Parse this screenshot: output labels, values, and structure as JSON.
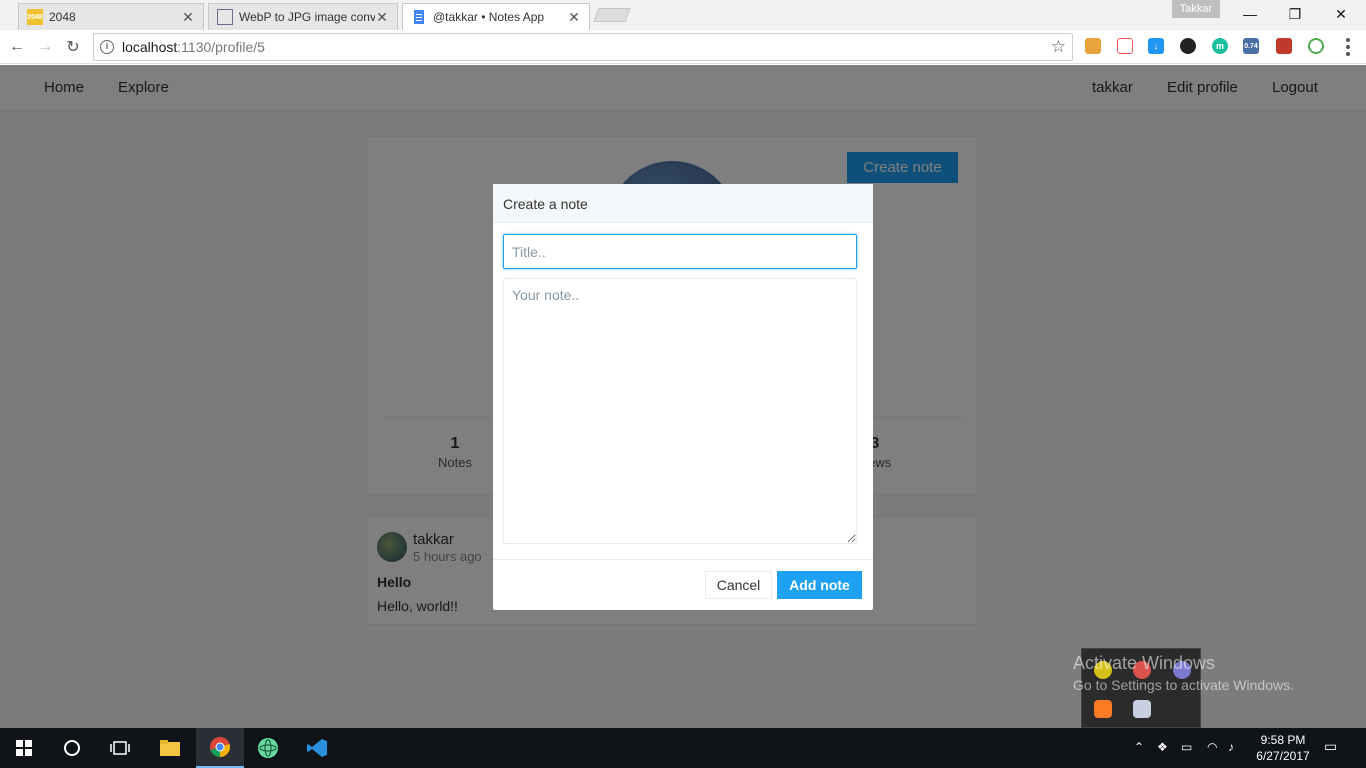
{
  "browser": {
    "tabs": [
      {
        "title": "2048",
        "favicon_text": "2048",
        "favicon_color": "#edc22e",
        "active": false
      },
      {
        "title": "WebP to JPG image conv",
        "favicon_text": "",
        "favicon_color": "#6b6b8f",
        "active": false
      },
      {
        "title": "@takkar • Notes App",
        "favicon_text": "",
        "favicon_color": "#4285f4",
        "active": true
      }
    ],
    "window_user": "Takkar",
    "window_controls": {
      "minimize": "—",
      "restore": "❐",
      "close": "✕"
    },
    "url_host": "localhost",
    "url_path": ":1130/profile/5",
    "extension_badge": "0.74"
  },
  "app": {
    "nav": {
      "home": "Home",
      "explore": "Explore",
      "username": "takkar",
      "edit_profile": "Edit profile",
      "logout": "Logout"
    },
    "profile": {
      "create_note_label": "Create note",
      "stats": [
        {
          "value": "1",
          "label": "Notes"
        },
        {
          "value": "3",
          "label": "views"
        }
      ]
    },
    "note": {
      "author": "takkar",
      "time": "5 hours ago",
      "title": "Hello",
      "body": "Hello, world!!"
    }
  },
  "modal": {
    "title": "Create a note",
    "title_placeholder": "Title..",
    "note_placeholder": "Your note..",
    "cancel_label": "Cancel",
    "add_label": "Add note"
  },
  "watermark": {
    "line1": "Activate Windows",
    "line2": "Go to Settings to activate Windows."
  },
  "taskbar": {
    "time": "9:58 PM",
    "date": "6/27/2017"
  },
  "colors": {
    "accent": "#1da1f2",
    "page_bg": "#f5f8fa"
  }
}
